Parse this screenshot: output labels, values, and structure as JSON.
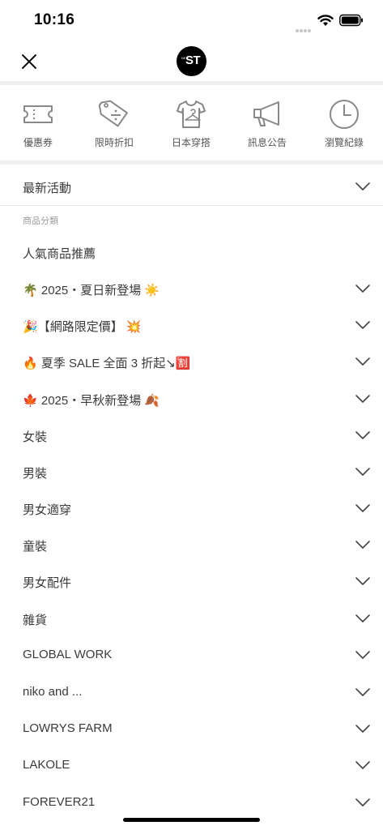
{
  "status_bar": {
    "time": "10:16"
  },
  "header": {
    "logo_text": "ST",
    "logo_small": "NET"
  },
  "quick_nav": [
    {
      "label": "優惠券",
      "icon": "ticket-icon"
    },
    {
      "label": "限時折扣",
      "icon": "discount-tag-icon"
    },
    {
      "label": "日本穿搭",
      "icon": "shirt-hanger-icon"
    },
    {
      "label": "訊息公告",
      "icon": "megaphone-icon"
    },
    {
      "label": "瀏覽紀錄",
      "icon": "clock-icon"
    }
  ],
  "menu": {
    "latest": "最新活動",
    "section_label": "商品分類",
    "recommended": "人氣商品推薦",
    "categories": [
      {
        "emoji": "🌴",
        "text": "2025・夏日新登場",
        "suffix": "☀️"
      },
      {
        "emoji": "🎉",
        "text": "【網路限定價】",
        "suffix": "💥"
      },
      {
        "emoji": "🔥",
        "text": "夏季 SALE 全面 3 折起↘",
        "suffix": "🈹"
      },
      {
        "emoji": "🍁",
        "text": "2025・早秋新登場",
        "suffix": "🍂"
      },
      {
        "emoji": "",
        "text": "女裝",
        "suffix": ""
      },
      {
        "emoji": "",
        "text": "男裝",
        "suffix": ""
      },
      {
        "emoji": "",
        "text": "男女適穿",
        "suffix": ""
      },
      {
        "emoji": "",
        "text": "童裝",
        "suffix": ""
      },
      {
        "emoji": "",
        "text": "男女配件",
        "suffix": ""
      },
      {
        "emoji": "",
        "text": "雜貨",
        "suffix": ""
      },
      {
        "emoji": "",
        "text": "GLOBAL WORK",
        "suffix": ""
      },
      {
        "emoji": "",
        "text": "niko and ...",
        "suffix": ""
      },
      {
        "emoji": "",
        "text": "LOWRYS FARM",
        "suffix": ""
      },
      {
        "emoji": "",
        "text": "LAKOLE",
        "suffix": ""
      },
      {
        "emoji": "",
        "text": "FOREVER21",
        "suffix": ""
      }
    ]
  }
}
